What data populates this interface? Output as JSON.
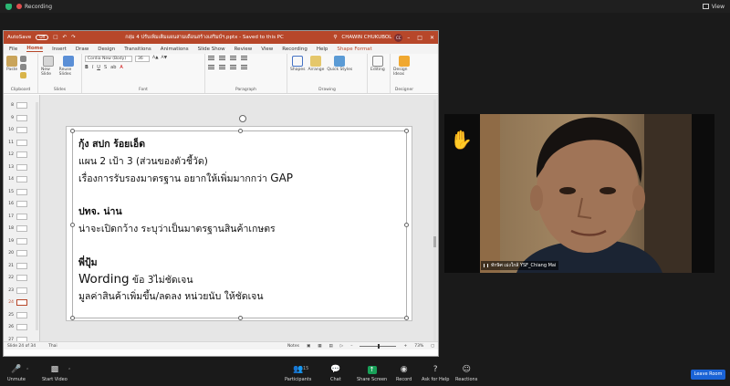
{
  "topbar": {
    "recording": "Recording",
    "view": "View"
  },
  "powerpoint": {
    "autosave_label": "AutoSave",
    "autosave_state": "Off",
    "doc_title": "กลุ่ม 4 ปรับเพิ่มเติมแผนสามเดือนสร้างเสริมบ์ฯ.pptx - Saved to this PC",
    "user_name": "CHAWIN CHUKUBOL",
    "user_initials": "CC",
    "tabs": [
      "File",
      "Home",
      "Insert",
      "Draw",
      "Design",
      "Transitions",
      "Animations",
      "Slide Show",
      "Review",
      "View",
      "Recording",
      "Help",
      "Shape Format"
    ],
    "ribbon": {
      "paste": "Paste",
      "new_slide": "New Slide",
      "reuse_slides": "Reuse Slides",
      "font_name": "Cordia New (Body)",
      "font_size": "36",
      "shapes": "Shapes",
      "arrange": "Arrange",
      "quick_styles": "Quick Styles",
      "editing": "Editing",
      "design_ideas": "Design Ideas",
      "groups": [
        "Clipboard",
        "Slides",
        "Font",
        "Paragraph",
        "Drawing",
        "Designer"
      ]
    },
    "slide_numbers": [
      "8",
      "9",
      "10",
      "11",
      "12",
      "13",
      "14",
      "15",
      "16",
      "17",
      "18",
      "19",
      "20",
      "21",
      "22",
      "23",
      "24",
      "25",
      "26",
      "27"
    ],
    "slide_lines": [
      "กุ้ง สปก ร้อยเอ็ด",
      "แผน 2 เป้า 3 (ส่วนของตัวชี้วัด)",
      "เรื่องการรับรองมาตรฐาน อยากให้เพิ่มมากกว่า",
      "GAP",
      "",
      "ปทจ. น่าน",
      "น่าจะเปิดกว้าง  ระบุว่าเป็นมาตรฐานสินค้าเกษตร",
      "",
      "พี่ปุ้ม",
      "Wording",
      "ข้อ 3ไม่ชัดเจน",
      "มูลค่าสินค้าเพิ่มขึ้น/ลดลง หน่วยนับ ให้ชัดเจน"
    ],
    "status": {
      "slide_position": "Slide 24 of 34",
      "language": "Thai",
      "notes": "Notes",
      "zoom": "73%"
    }
  },
  "video": {
    "participant_name": "ทักษิศ เม่งใกล้ YSF_Chiang Mai"
  },
  "controls": {
    "unmute": "Unmute",
    "start_video": "Start Video",
    "participants": "Participants",
    "participant_count": "15",
    "chat": "Chat",
    "share_screen": "Share Screen",
    "record": "Record",
    "ask_help": "Ask for Help",
    "reactions": "Reactions",
    "leave": "Leave Room"
  },
  "colors": {
    "ppt_accent": "#b7472a",
    "share_green": "#18a058",
    "leave_blue": "#1a63d6"
  }
}
